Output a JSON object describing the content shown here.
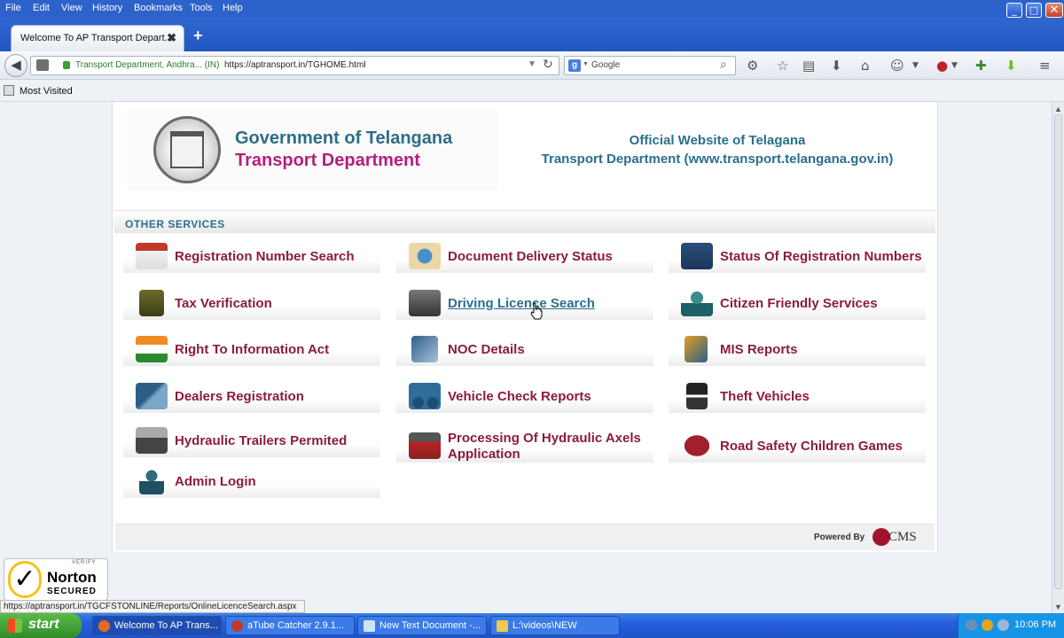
{
  "menubar": {
    "items": [
      "File",
      "Edit",
      "View",
      "History",
      "Bookmarks",
      "Tools",
      "Help"
    ]
  },
  "tab": {
    "title": "Welcome To AP Transport Depart...",
    "close": "✖",
    "new": "+"
  },
  "navbar": {
    "identity": "Transport Department, Andhra... (IN)",
    "url": "https://aptransport.in/TGHOME.html",
    "search_placeholder": "Google",
    "search_engine_icon": "g-icon"
  },
  "bookmarks": {
    "label": "Most Visited"
  },
  "header": {
    "gov_title": "Government of Telangana",
    "dept_title": "Transport Department",
    "official_line1": "Official Website of Telagana",
    "official_line2": "Transport Department (www.transport.telangana.gov.in)"
  },
  "services": {
    "title": "OTHER SERVICES",
    "items": [
      {
        "label": "Registration Number Search",
        "icon": "registration-search-icon"
      },
      {
        "label": "Document Delivery Status",
        "icon": "document-delivery-icon"
      },
      {
        "label": "Status Of Registration Numbers",
        "icon": "number-plate-icon"
      },
      {
        "label": "Tax Verification",
        "icon": "tax-verification-icon"
      },
      {
        "label": "Driving Licence Search",
        "icon": "driving-licence-icon"
      },
      {
        "label": "Citizen Friendly Services",
        "icon": "citizen-services-icon"
      },
      {
        "label": "Right To Information Act",
        "icon": "india-flag-icon"
      },
      {
        "label": "NOC Details",
        "icon": "noc-details-icon"
      },
      {
        "label": "MIS Reports",
        "icon": "mis-reports-icon"
      },
      {
        "label": "Dealers Registration",
        "icon": "handshake-icon"
      },
      {
        "label": "Vehicle Check Reports",
        "icon": "vehicle-check-icon"
      },
      {
        "label": "Theft Vehicles",
        "icon": "theft-vehicle-icon"
      },
      {
        "label": "Hydraulic Trailers Permited",
        "icon": "trailer-icon"
      },
      {
        "label": "Processing Of Hydraulic Axels Application",
        "icon": "hydraulic-axle-icon"
      },
      {
        "label": "Road Safety Children Games",
        "icon": "gamepad-icon"
      },
      {
        "label": "Admin Login",
        "icon": "admin-user-icon"
      }
    ]
  },
  "footer": {
    "powered_by": "Powered By",
    "cms": "CMS"
  },
  "norton": {
    "verify": "VERIFY",
    "name": "Norton",
    "secured": "SECURED"
  },
  "statusbar": {
    "text": "https://aptransport.in/TGCFSTONLINE/Reports/OnlineLicenceSearch.aspx"
  },
  "taskbar": {
    "start": "start",
    "buttons": [
      {
        "label": "Welcome To AP Trans...",
        "active": true
      },
      {
        "label": "aTube Catcher 2.9.1...",
        "active": false
      },
      {
        "label": "New Text Document -...",
        "active": false
      },
      {
        "label": "L:\\videos\\NEW",
        "active": false
      }
    ],
    "time": "10:06 PM"
  },
  "colors": {
    "service_label": "#8a1c3c",
    "link": "#2a6f8e",
    "gov_title": "#2d6e86",
    "dept_title": "#b51f7c"
  }
}
